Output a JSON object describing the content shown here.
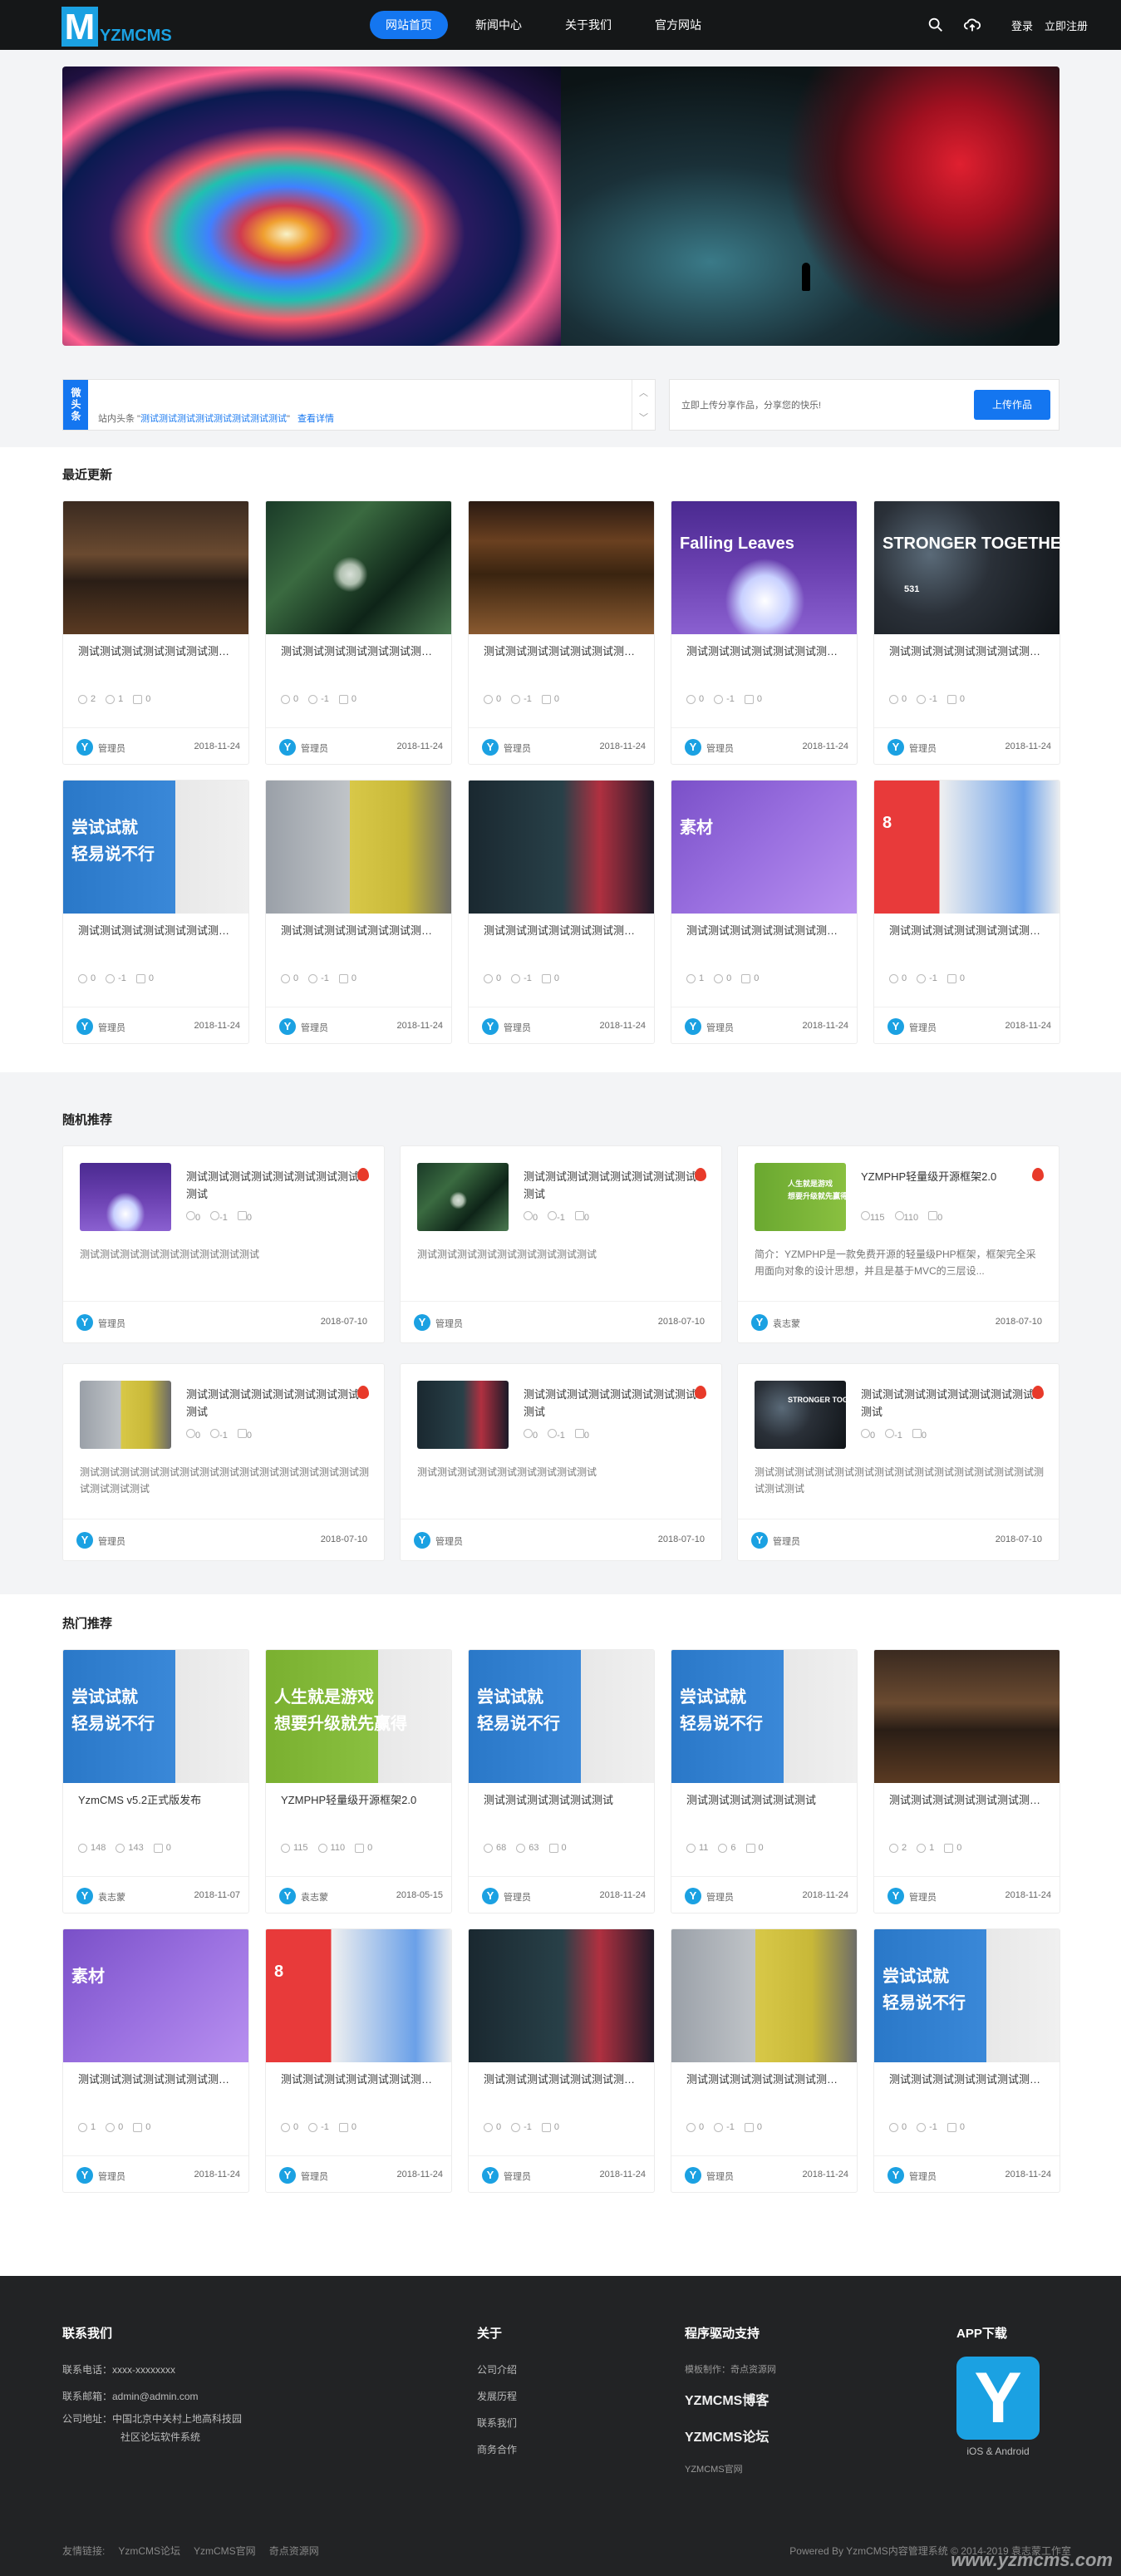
{
  "header": {
    "logo_letter": "M",
    "logo_text": "YZMCMS",
    "nav": [
      "网站首页",
      "新闻中心",
      "关于我们",
      "官方网站"
    ],
    "login": "登录",
    "register": "立即注册"
  },
  "news": {
    "tag": "微头条",
    "prefix": "站内头条 \"",
    "headline": "测试测试测试测试测试测试测试测试",
    "suffix": "\"",
    "more": "查看详情"
  },
  "upload": {
    "text": "立即上传分享作品，分享您的快乐!",
    "button": "上传作品"
  },
  "latest": {
    "title": "最近更新",
    "cards": [
      {
        "art": "t-cafe",
        "title": "测试测试测试测试测试测试测试测试",
        "s": [
          "2",
          "1",
          "0"
        ],
        "user": "管理员",
        "date": "2018-11-24"
      },
      {
        "art": "t-plant",
        "title": "测试测试测试测试测试测试测试测试",
        "s": [
          "0",
          "-1",
          "0"
        ],
        "user": "管理员",
        "date": "2018-11-24"
      },
      {
        "art": "t-shop",
        "title": "测试测试测试测试测试测试测试测试",
        "s": [
          "0",
          "-1",
          "0"
        ],
        "user": "管理员",
        "date": "2018-11-24"
      },
      {
        "art": "t-phone",
        "title": "测试测试测试测试测试测试测试测试",
        "s": [
          "0",
          "-1",
          "0"
        ],
        "user": "管理员",
        "date": "2018-11-24",
        "overlay": "Falling Leaves"
      },
      {
        "art": "t-strong",
        "title": "测试测试测试测试测试测试测试测试",
        "s": [
          "0",
          "-1",
          "0"
        ],
        "user": "管理员",
        "date": "2018-11-24",
        "overlay": "STRONGER TOGETHER",
        "num": "531"
      },
      {
        "art": "t-game",
        "title": "测试测试测试测试测试测试测试测试",
        "s": [
          "0",
          "-1",
          "0"
        ],
        "user": "管理员",
        "date": "2018-11-24",
        "overlay": "尝试试就",
        "overlay2": "轻易说不行"
      },
      {
        "art": "t-office",
        "title": "测试测试测试测试测试测试测试测试",
        "s": [
          "0",
          "-1",
          "0"
        ],
        "user": "管理员",
        "date": "2018-11-24"
      },
      {
        "art": "t-blue",
        "title": "测试测试测试测试测试测试测试测试",
        "s": [
          "0",
          "-1",
          "0"
        ],
        "user": "管理员",
        "date": "2018-11-24"
      },
      {
        "art": "t-flamingo",
        "title": "测试测试测试测试测试测试测试测试",
        "s": [
          "1",
          "0",
          "0"
        ],
        "user": "管理员",
        "date": "2018-11-24",
        "overlay": "素材"
      },
      {
        "art": "t-red",
        "title": "测试测试测试测试测试测试测试测试",
        "s": [
          "0",
          "-1",
          "0"
        ],
        "user": "管理员",
        "date": "2018-11-24",
        "overlay": "8"
      }
    ]
  },
  "random": {
    "title": "随机推荐",
    "cards": [
      {
        "art": "t-phone",
        "title": "测试测试测试测试测试测试测试测试测试",
        "s": [
          "0",
          "-1",
          "0"
        ],
        "desc": "测试测试测试测试测试测试测试测试测试",
        "user": "管理员",
        "date": "2018-07-10"
      },
      {
        "art": "t-plant",
        "title": "测试测试测试测试测试测试测试测试测试",
        "s": [
          "0",
          "-1",
          "0"
        ],
        "desc": "测试测试测试测试测试测试测试测试测试",
        "user": "管理员",
        "date": "2018-07-10"
      },
      {
        "art": "t-green",
        "title": "YZMPHP轻量级开源框架2.0",
        "s": [
          "115",
          "110",
          "0"
        ],
        "desc": "简介：YZMPHP是一款免费开源的轻量级PHP框架，框架完全采用面向对象的设计思想，并且是基于MVC的三层设...",
        "user": "袁志蒙",
        "date": "2018-07-10",
        "overlay": "人生就是游戏",
        "overlay2": "想要升级就先赢得"
      },
      {
        "art": "t-office",
        "title": "测试测试测试测试测试测试测试测试测试",
        "s": [
          "0",
          "-1",
          "0"
        ],
        "desc": "测试测试测试测试测试测试测试测试测试测试测试测试测试测试测试测试测试测试",
        "user": "管理员",
        "date": "2018-07-10"
      },
      {
        "art": "t-blue",
        "title": "测试测试测试测试测试测试测试测试测试",
        "s": [
          "0",
          "-1",
          "0"
        ],
        "desc": "测试测试测试测试测试测试测试测试测试",
        "user": "管理员",
        "date": "2018-07-10"
      },
      {
        "art": "t-strong",
        "title": "测试测试测试测试测试测试测试测试测试",
        "s": [
          "0",
          "-1",
          "0"
        ],
        "desc": "测试测试测试测试测试测试测试测试测试测试测试测试测试测试测试测试测试",
        "user": "管理员",
        "date": "2018-07-10",
        "overlay": "STRONGER TOGETHER"
      }
    ]
  },
  "hot": {
    "title": "热门推荐",
    "cards": [
      {
        "art": "t-game",
        "title": "YzmCMS v5.2正式版发布",
        "s": [
          "148",
          "143",
          "0"
        ],
        "user": "袁志蒙",
        "date": "2018-11-07",
        "overlay": "尝试试就",
        "overlay2": "轻易说不行"
      },
      {
        "art": "t-game2",
        "title": "YZMPHP轻量级开源框架2.0",
        "s": [
          "115",
          "110",
          "0"
        ],
        "user": "袁志蒙",
        "date": "2018-05-15",
        "overlay": "人生就是游戏",
        "overlay2": "想要升级就先赢得"
      },
      {
        "art": "t-game",
        "title": "测试测试测试测试测试测试",
        "s": [
          "68",
          "63",
          "0"
        ],
        "user": "管理员",
        "date": "2018-11-24",
        "overlay": "尝试试就",
        "overlay2": "轻易说不行"
      },
      {
        "art": "t-game",
        "title": "测试测试测试测试测试测试",
        "s": [
          "11",
          "6",
          "0"
        ],
        "user": "管理员",
        "date": "2018-11-24",
        "overlay": "尝试试就",
        "overlay2": "轻易说不行"
      },
      {
        "art": "t-cafe",
        "title": "测试测试测试测试测试测试测试测试",
        "s": [
          "2",
          "1",
          "0"
        ],
        "user": "管理员",
        "date": "2018-11-24"
      },
      {
        "art": "t-flamingo",
        "title": "测试测试测试测试测试测试测试测试",
        "s": [
          "1",
          "0",
          "0"
        ],
        "user": "管理员",
        "date": "2018-11-24",
        "overlay": "素材"
      },
      {
        "art": "t-red",
        "title": "测试测试测试测试测试测试测试测试",
        "s": [
          "0",
          "-1",
          "0"
        ],
        "user": "管理员",
        "date": "2018-11-24",
        "overlay": "8"
      },
      {
        "art": "t-blue",
        "title": "测试测试测试测试测试测试测试测试",
        "s": [
          "0",
          "-1",
          "0"
        ],
        "user": "管理员",
        "date": "2018-11-24"
      },
      {
        "art": "t-office",
        "title": "测试测试测试测试测试测试测试测试",
        "s": [
          "0",
          "-1",
          "0"
        ],
        "user": "管理员",
        "date": "2018-11-24"
      },
      {
        "art": "t-game",
        "title": "测试测试测试测试测试测试测试测试",
        "s": [
          "0",
          "-1",
          "0"
        ],
        "user": "管理员",
        "date": "2018-11-24",
        "overlay": "尝试试就",
        "overlay2": "轻易说不行"
      }
    ]
  },
  "footer": {
    "contact_title": "联系我们",
    "phone": "联系电话：xxxx-xxxxxxxx",
    "email": "联系邮箱：admin@admin.com",
    "addr1": "公司地址：中国北京中关村上地高科技园",
    "addr2": "社区论坛软件系统",
    "about_title": "关于",
    "about_links": [
      "公司介绍",
      "发展历程",
      "联系我们",
      "商务合作"
    ],
    "support_title": "程序驱动支持",
    "support_line": "模板制作：奇点资源网",
    "logos": [
      "YZMCMS博客",
      "YZMCMS论坛"
    ],
    "official": "YZMCMS官网",
    "app_title": "APP下载",
    "app_letter": "Y",
    "app_caption": "iOS & Android",
    "friend_prefix": "友情链接:",
    "friend_links": [
      "YzmCMS论坛",
      "YzmCMS官网",
      "奇点资源网"
    ],
    "copyright": "Powered By YzmCMS内容管理系统 © 2014-2019 袁志蒙工作室",
    "watermark": "www.yzmcms.com"
  },
  "colors": {
    "accent": "#1476f0",
    "brand": "#1ba1e2",
    "header": "#151718",
    "footer": "#222325"
  }
}
